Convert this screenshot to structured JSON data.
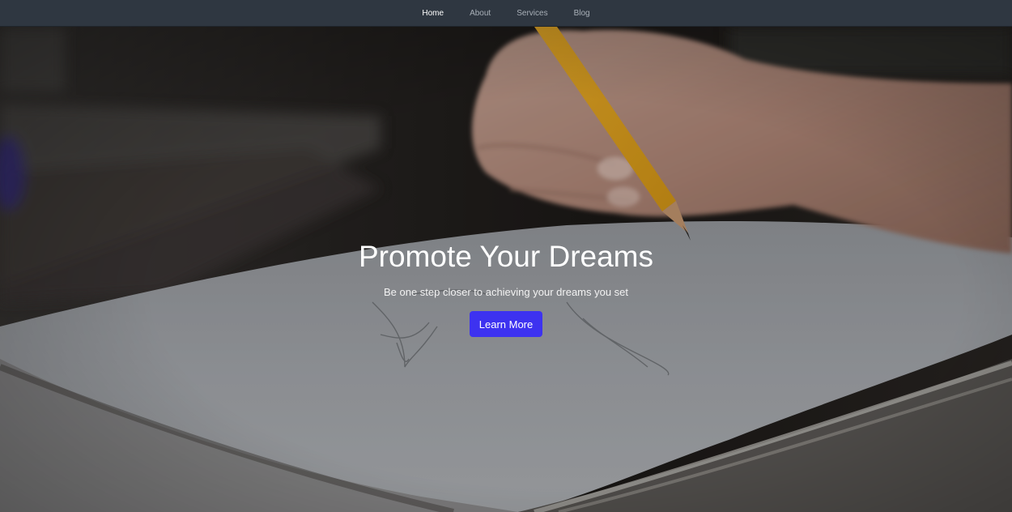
{
  "nav": {
    "items": [
      {
        "label": "Home",
        "active": true
      },
      {
        "label": "About",
        "active": false
      },
      {
        "label": "Services",
        "active": false
      },
      {
        "label": "Blog",
        "active": false
      }
    ]
  },
  "hero": {
    "title": "Promote Your Dreams",
    "subtitle": "Be one step closer to achieving your dreams you set",
    "button_label": "Learn More",
    "background_image": "hand drawing a sketch with a yellow pencil on a sketchbook"
  },
  "colors": {
    "navbar_bg": "#2f3741",
    "nav_active": "#ffffff",
    "nav_inactive": "#a9b0b8",
    "button_bg": "#3d32f0",
    "button_text": "#ffffff"
  }
}
